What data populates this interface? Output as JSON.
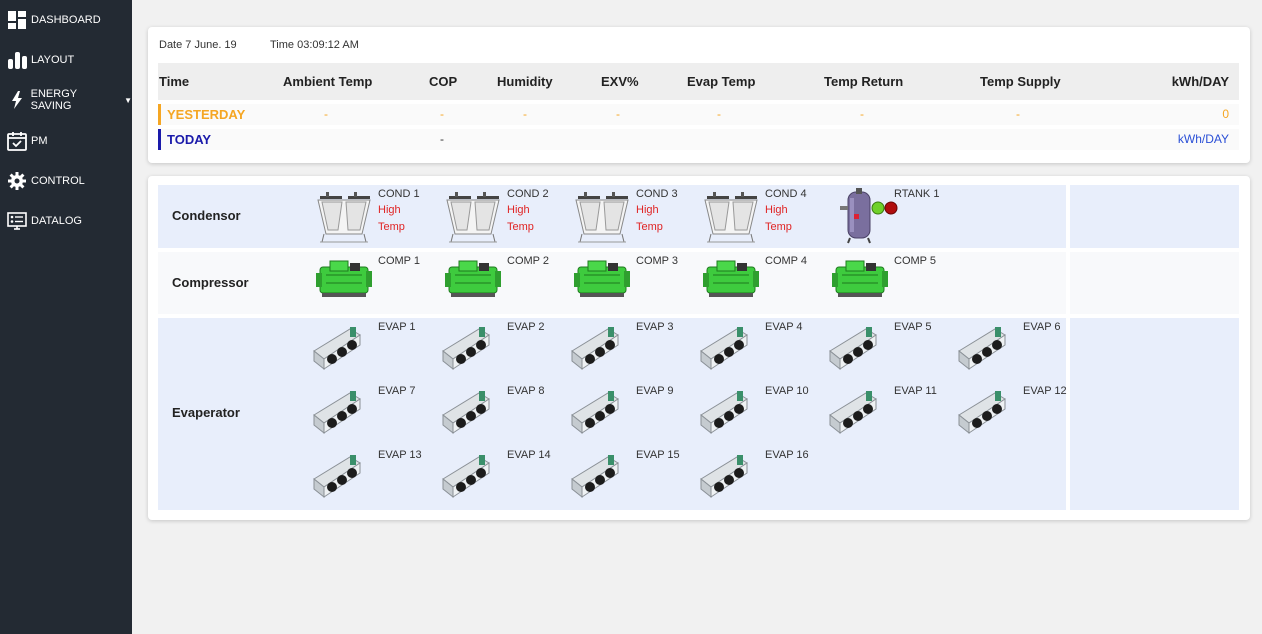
{
  "nav": {
    "items": [
      {
        "label": "DASHBOARD",
        "icon": "dashboard-icon"
      },
      {
        "label": "LAYOUT",
        "icon": "bar-chart-icon"
      },
      {
        "label": "ENERGY SAVING",
        "icon": "lightning-icon"
      },
      {
        "label": "PM",
        "icon": "calendar-check-icon"
      },
      {
        "label": "CONTROL",
        "icon": "gear-icon"
      },
      {
        "label": "DATALOG",
        "icon": "monitor-list-icon"
      }
    ]
  },
  "summary": {
    "date": "Date 7 June. 19",
    "time": "Time 03:09:12 AM",
    "headers": [
      "Time",
      "Ambient Temp",
      "COP",
      "Humidity",
      "EXV%",
      "Evap Temp",
      "Temp Return",
      "Temp Supply",
      "kWh/DAY"
    ],
    "yesterday": {
      "label": "YESTERDAY",
      "ambient": "-",
      "cop": "-",
      "humidity": "-",
      "exv": "-",
      "evap": "-",
      "return": "-",
      "supply": "-",
      "kwh": "0"
    },
    "today": {
      "label": "TODAY",
      "cop": "-",
      "kwh": "kWh/DAY"
    },
    "colors": {
      "yesterday": "#f5a623",
      "today": "#1a1aaa",
      "today_kwh": "#2a4fd6"
    }
  },
  "equipment": {
    "condensor": {
      "title": "Condensor",
      "units": [
        "COND 1",
        "COND 2",
        "COND 3",
        "COND 4"
      ],
      "warning_line1": "High",
      "warning_line2": "Temp",
      "tank": "RTANK 1"
    },
    "compressor": {
      "title": "Compressor",
      "units": [
        "COMP 1",
        "COMP 2",
        "COMP 3",
        "COMP 4",
        "COMP 5"
      ]
    },
    "evaporator": {
      "title": "Evaperator",
      "units": [
        "EVAP 1",
        "EVAP 2",
        "EVAP 3",
        "EVAP 4",
        "EVAP 5",
        "EVAP 6",
        "EVAP 7",
        "EVAP 8",
        "EVAP 9",
        "EVAP 10",
        "EVAP 11",
        "EVAP 12",
        "EVAP 13",
        "EVAP 14",
        "EVAP 15",
        "EVAP 16"
      ]
    }
  }
}
